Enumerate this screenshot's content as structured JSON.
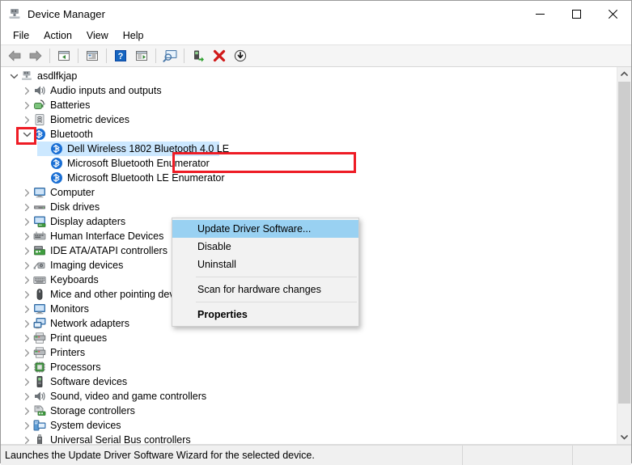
{
  "window": {
    "title": "Device Manager",
    "title_icon": "device-manager-icon",
    "caption": {
      "minimize": "minimize-icon",
      "maximize": "maximize-icon",
      "close": "close-icon"
    }
  },
  "menubar": {
    "items": [
      "File",
      "Action",
      "View",
      "Help"
    ]
  },
  "toolbar": {
    "buttons": [
      {
        "name": "back-icon",
        "kind": "arrow-left"
      },
      {
        "name": "forward-icon",
        "kind": "arrow-right"
      },
      {
        "name": "separator",
        "kind": "sep"
      },
      {
        "name": "show-hidden-devices-icon",
        "kind": "panel-left"
      },
      {
        "name": "separator",
        "kind": "sep"
      },
      {
        "name": "properties-icon",
        "kind": "panel-props"
      },
      {
        "name": "separator",
        "kind": "sep"
      },
      {
        "name": "help-icon",
        "kind": "help"
      },
      {
        "name": "update-driver-icon",
        "kind": "panel-play"
      },
      {
        "name": "separator",
        "kind": "sep"
      },
      {
        "name": "scan-for-hardware-changes-icon",
        "kind": "monitor-scan"
      },
      {
        "name": "separator",
        "kind": "sep"
      },
      {
        "name": "enable-device-icon",
        "kind": "device-enable"
      },
      {
        "name": "uninstall-device-icon",
        "kind": "red-x"
      },
      {
        "name": "disable-device-icon",
        "kind": "down-circle"
      }
    ]
  },
  "tree": {
    "rows": [
      {
        "label": "asdlfkjap",
        "depth": 0,
        "twisty": "expanded",
        "icon": "computer-icon",
        "selected": false
      },
      {
        "label": "Audio inputs and outputs",
        "depth": 1,
        "twisty": "collapsed",
        "icon": "speaker-icon",
        "selected": false
      },
      {
        "label": "Batteries",
        "depth": 1,
        "twisty": "collapsed",
        "icon": "battery-icon",
        "selected": false
      },
      {
        "label": "Biometric devices",
        "depth": 1,
        "twisty": "collapsed",
        "icon": "fingerprint-icon",
        "selected": false
      },
      {
        "label": "Bluetooth",
        "depth": 1,
        "twisty": "expanded",
        "icon": "bluetooth-icon",
        "selected": false
      },
      {
        "label": "Dell Wireless 1802 Bluetooth 4.0 LE",
        "depth": 2,
        "twisty": "none",
        "icon": "bluetooth-icon",
        "selected": true
      },
      {
        "label": "Microsoft Bluetooth Enumerator",
        "depth": 2,
        "twisty": "none",
        "icon": "bluetooth-icon",
        "selected": false
      },
      {
        "label": "Microsoft Bluetooth LE Enumerator",
        "depth": 2,
        "twisty": "none",
        "icon": "bluetooth-icon",
        "selected": false
      },
      {
        "label": "Computer",
        "depth": 1,
        "twisty": "collapsed",
        "icon": "monitor-icon",
        "selected": false
      },
      {
        "label": "Disk drives",
        "depth": 1,
        "twisty": "collapsed",
        "icon": "disk-icon",
        "selected": false
      },
      {
        "label": "Display adapters",
        "depth": 1,
        "twisty": "collapsed",
        "icon": "display-adapter-icon",
        "selected": false
      },
      {
        "label": "Human Interface Devices",
        "depth": 1,
        "twisty": "collapsed",
        "icon": "hid-icon",
        "selected": false
      },
      {
        "label": "IDE ATA/ATAPI controllers",
        "depth": 1,
        "twisty": "collapsed",
        "icon": "ide-controller-icon",
        "selected": false
      },
      {
        "label": "Imaging devices",
        "depth": 1,
        "twisty": "collapsed",
        "icon": "camera-icon",
        "selected": false
      },
      {
        "label": "Keyboards",
        "depth": 1,
        "twisty": "collapsed",
        "icon": "keyboard-icon",
        "selected": false
      },
      {
        "label": "Mice and other pointing devices",
        "depth": 1,
        "twisty": "collapsed",
        "icon": "mouse-icon",
        "selected": false
      },
      {
        "label": "Monitors",
        "depth": 1,
        "twisty": "collapsed",
        "icon": "monitor-icon",
        "selected": false
      },
      {
        "label": "Network adapters",
        "depth": 1,
        "twisty": "collapsed",
        "icon": "network-adapter-icon",
        "selected": false
      },
      {
        "label": "Print queues",
        "depth": 1,
        "twisty": "collapsed",
        "icon": "printer-icon",
        "selected": false
      },
      {
        "label": "Printers",
        "depth": 1,
        "twisty": "collapsed",
        "icon": "printer-icon",
        "selected": false
      },
      {
        "label": "Processors",
        "depth": 1,
        "twisty": "collapsed",
        "icon": "processor-icon",
        "selected": false
      },
      {
        "label": "Software devices",
        "depth": 1,
        "twisty": "collapsed",
        "icon": "software-device-icon",
        "selected": false
      },
      {
        "label": "Sound, video and game controllers",
        "depth": 1,
        "twisty": "collapsed",
        "icon": "speaker-icon",
        "selected": false
      },
      {
        "label": "Storage controllers",
        "depth": 1,
        "twisty": "collapsed",
        "icon": "storage-controller-icon",
        "selected": false
      },
      {
        "label": "System devices",
        "depth": 1,
        "twisty": "collapsed",
        "icon": "system-device-icon",
        "selected": false
      },
      {
        "label": "Universal Serial Bus controllers",
        "depth": 1,
        "twisty": "collapsed",
        "icon": "usb-icon",
        "selected": false
      }
    ]
  },
  "context_menu": {
    "items": [
      {
        "label": "Update Driver Software...",
        "highlighted": true,
        "bold": false,
        "separator_after": false
      },
      {
        "label": "Disable",
        "highlighted": false,
        "bold": false,
        "separator_after": false
      },
      {
        "label": "Uninstall",
        "highlighted": false,
        "bold": false,
        "separator_after": true
      },
      {
        "label": "Scan for hardware changes",
        "highlighted": false,
        "bold": false,
        "separator_after": true
      },
      {
        "label": "Properties",
        "highlighted": false,
        "bold": true,
        "separator_after": false
      }
    ]
  },
  "annotations": {
    "color": "#ee1c25",
    "boxes": [
      "bluetooth-twisty-highlight",
      "update-driver-menu-highlight"
    ]
  },
  "statusbar": {
    "message": "Launches the Update Driver Software Wizard for the selected device.",
    "cell2": "",
    "cell3": ""
  },
  "colors": {
    "selection": "#cce8ff",
    "menu_highlight": "#99d1f2",
    "annotation_red": "#ee1c25",
    "toolbar_bg": "#f5f5f5",
    "statusbar_bg": "#f0f0f0"
  }
}
